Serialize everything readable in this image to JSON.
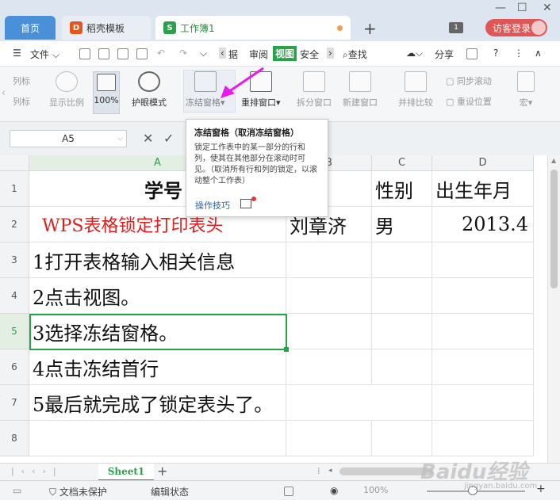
{
  "titlebar": {
    "tabs": [
      {
        "label": "首页"
      },
      {
        "label": "稻壳模板"
      },
      {
        "label": "工作簿1"
      }
    ],
    "badge": "1",
    "login": "访客登录"
  },
  "menubar": {
    "file": "文件",
    "items": [
      "据",
      "审阅",
      "视图",
      "安全"
    ],
    "search": "查找",
    "share": "分享"
  },
  "ribbon": {
    "items": [
      {
        "label": "列标"
      },
      {
        "label": "列标"
      },
      {
        "label": "显示比例"
      },
      {
        "label": "100%"
      },
      {
        "label": "护眼模式"
      },
      {
        "label": "冻结窗格"
      },
      {
        "label": "重排窗口"
      },
      {
        "label": "拆分窗口"
      },
      {
        "label": "新建窗口"
      },
      {
        "label": "并排比较"
      },
      {
        "label": "同步滚动"
      },
      {
        "label": "重设位置"
      },
      {
        "label": "宏"
      }
    ]
  },
  "formulabar": {
    "namebox": "A5"
  },
  "grid": {
    "columns": [
      "A",
      "B",
      "C",
      "D"
    ],
    "rows": [
      "1",
      "2",
      "3",
      "4",
      "5",
      "6",
      "7",
      "8"
    ],
    "cells": {
      "A1": "学号",
      "B1": "名",
      "C1": "性别",
      "D1": "出生年月",
      "A2": "WPS表格锁定打印表头",
      "B2": "刘章济",
      "C2": "男",
      "D2": "2013.4",
      "A3": "1打开表格输入相关信息",
      "A4": "2点击视图。",
      "A5": "3选择冻结窗格。",
      "A6": "4点击冻结首行",
      "A7": "5最后就完成了锁定表头了。"
    },
    "red_color": "#e01e1e"
  },
  "tooltip": {
    "title": "冻结窗格（取消冻结窗格）",
    "body": "锁定工作表中的某一部分的行和列，使其在其他部分在滚动时可见。（取消所有行和列的锁定，以滚动整个工作表）",
    "link": "操作技巧"
  },
  "sheetbar": {
    "sheet": "Sheet1"
  },
  "statusbar": {
    "protect": "文档未保护",
    "mode": "编辑状态",
    "zoom": "100%"
  },
  "watermark": {
    "text": "Baidu经验",
    "sub": "jingyan.baidu.com"
  },
  "colors": {
    "accent_green": "#2aa14a",
    "arrow_magenta": "#e81ce8"
  }
}
